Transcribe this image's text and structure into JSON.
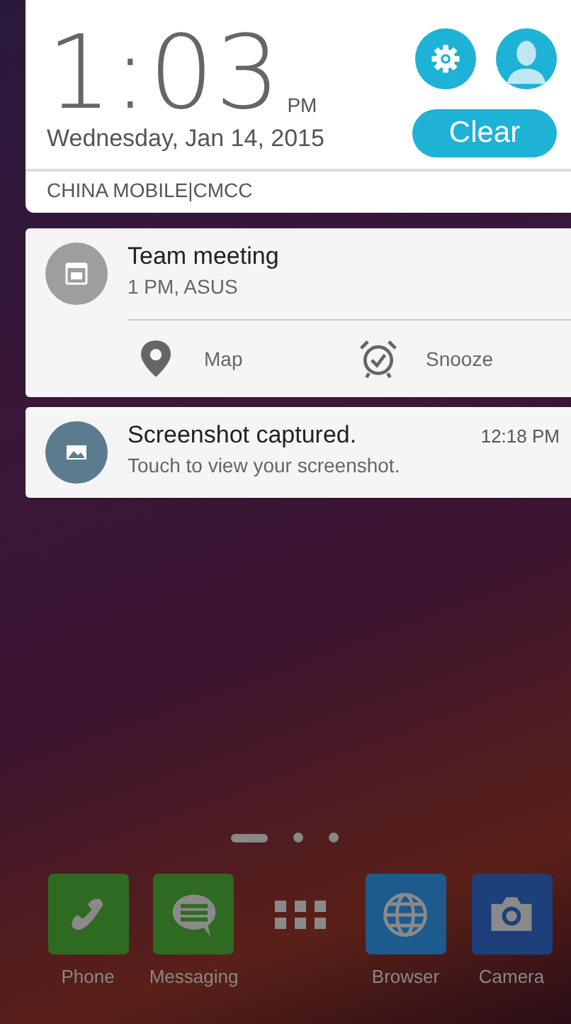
{
  "clock": {
    "time": "1:03",
    "ampm": "PM",
    "date": "Wednesday, Jan 14, 2015"
  },
  "clear_button": "Clear",
  "carrier": "CHINA MOBILE|CMCC",
  "notifications": [
    {
      "kind": "calendar",
      "title": "Team meeting",
      "text": "1 PM, ASUS",
      "actions": [
        {
          "kind": "map",
          "label": "Map"
        },
        {
          "kind": "snooze",
          "label": "Snooze"
        }
      ]
    },
    {
      "kind": "screenshot",
      "title": "Screenshot captured.",
      "time": "12:18 PM",
      "text": "Touch to view your screenshot."
    }
  ],
  "pages": [
    {
      "selected": true
    },
    {
      "selected": false
    },
    {
      "selected": false
    }
  ],
  "dock": [
    {
      "kind": "phone",
      "label": "Phone"
    },
    {
      "kind": "messaging",
      "label": "Messaging"
    },
    {
      "kind": "apps"
    },
    {
      "kind": "browser",
      "label": "Browser"
    },
    {
      "kind": "camera",
      "label": "Camera"
    }
  ]
}
